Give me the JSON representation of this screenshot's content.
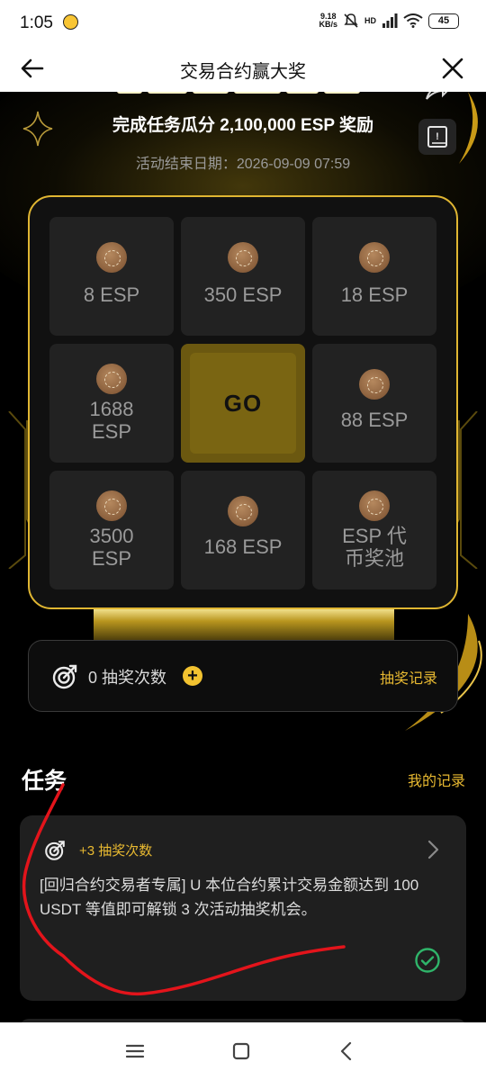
{
  "status_bar": {
    "time": "1:05",
    "net_speed": "9.18",
    "net_unit": "KB/s",
    "network": "HD",
    "battery": "45"
  },
  "header": {
    "title": "交易合约赢大奖"
  },
  "banner": {
    "subtitle": "完成任务瓜分 2,100,000 ESP 奖励",
    "end_date": "活动结束日期：2026-09-09 07:59"
  },
  "prizes": [
    {
      "label": "8 ESP"
    },
    {
      "label": "350 ESP"
    },
    {
      "label": "18 ESP"
    },
    {
      "label": "1688\nESP"
    },
    {
      "label": "88 ESP"
    },
    {
      "label": "3500\nESP"
    },
    {
      "label": "168 ESP"
    },
    {
      "label": "ESP 代\n币奖池"
    }
  ],
  "go_label": "GO",
  "draws": {
    "count_text": "0 抽奖次数",
    "plus": "+",
    "record_label": "抽奖记录"
  },
  "tasks": {
    "title": "任务",
    "my_records": "我的记录",
    "items": [
      {
        "reward": "+3 抽奖次数",
        "description": "[回归合约交易者专属] U 本位合约累计交易金额达到 100 USDT 等值即可解锁 3 次活动抽奖机会。"
      }
    ]
  },
  "colors": {
    "accent": "#e8b931",
    "board_border": "#e0b632",
    "annotation": "#e3141b",
    "check": "#2fb56a"
  },
  "icons": [
    "back-arrow-icon",
    "close-icon",
    "share-icon",
    "rule-book-icon",
    "lottery-target-icon",
    "plus-icon",
    "chevron-right-icon",
    "check-circle-icon",
    "menu-icon",
    "home-icon",
    "back-icon"
  ]
}
